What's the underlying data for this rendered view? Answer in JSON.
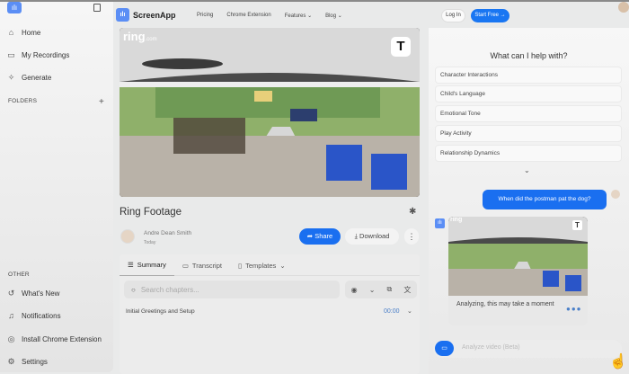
{
  "sidebar": {
    "nav": [
      {
        "label": "Home",
        "icon": "home-icon"
      },
      {
        "label": "My Recordings",
        "icon": "recordings-icon"
      },
      {
        "label": "Generate",
        "icon": "sparkle-icon"
      }
    ],
    "folders_label": "FOLDERS",
    "other_label": "OTHER",
    "other": [
      {
        "label": "What's New"
      },
      {
        "label": "Notifications"
      },
      {
        "label": "Install Chrome Extension"
      },
      {
        "label": "Settings"
      }
    ]
  },
  "header": {
    "brand": "ScreenApp",
    "menu": [
      "Pricing",
      "Chrome Extension",
      "Features",
      "Blog"
    ],
    "login": "Log In",
    "start": "Start Free →"
  },
  "video": {
    "brand": "ring",
    "brand_suffix": ".com",
    "badge": "T"
  },
  "recording": {
    "title": "Ring Footage",
    "author": "Andre Dean Smith",
    "date": "Today",
    "share": "Share",
    "download": "Download"
  },
  "tabs": {
    "summary": "Summary",
    "transcript": "Transcript",
    "templates": "Templates"
  },
  "chapters": {
    "search_placeholder": "Search chapters...",
    "items": [
      {
        "title": "Initial Greetings and Setup",
        "time": "00:00"
      }
    ]
  },
  "chat": {
    "title": "What can I help with?",
    "suggestions": [
      "Character Interactions",
      "Child's Language",
      "Emotional Tone",
      "Play Activity",
      "Relationship Dynamics"
    ],
    "question": "When did the postman pat the dog?",
    "reply": "Analyzing, this may take a moment",
    "input_placeholder": "Analyze video (Beta)"
  }
}
